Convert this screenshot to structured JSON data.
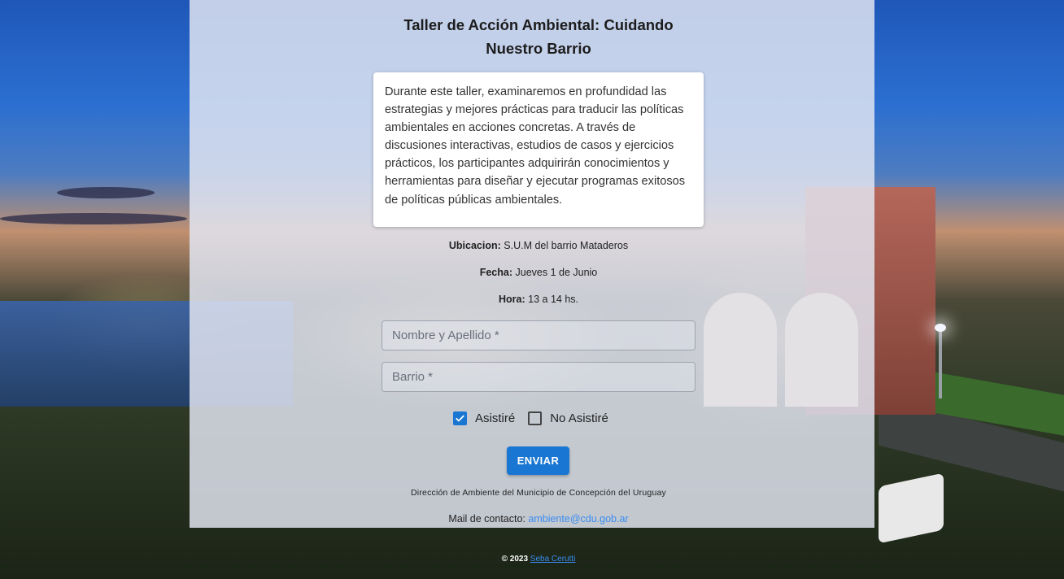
{
  "event": {
    "title": "Taller de Acción Ambiental: Cuidando Nuestro Barrio",
    "description": "Durante este taller, examinaremos en profundidad las estrategias y mejores prácticas para traducir las políticas ambientales en acciones concretas. A través de discusiones interactivas, estudios de casos y ejercicios prácticos, los participantes adquirirán conocimientos y herramientas para diseñar y ejecutar programas exitosos de políticas públicas ambientales.",
    "location_label": "Ubicacion:",
    "location_value": "S.U.M del barrio Mataderos",
    "date_label": "Fecha:",
    "date_value": "Jueves 1 de Junio",
    "hour_label": "Hora:",
    "hour_value": "13 a 14 hs."
  },
  "form": {
    "name_placeholder": "Nombre y Apellido *",
    "barrio_placeholder": "Barrio *",
    "attend_label": "Asistiré",
    "attend_checked": true,
    "not_attend_label": "No Asistiré",
    "not_attend_checked": false,
    "submit_label": "ENVIAR"
  },
  "contact": {
    "organization": "Dirección de Ambiente del Municipio de Concepción del Uruguay",
    "mail_label": "Mail de contacto:",
    "mail_value": "ambiente@cdu.gob.ar"
  },
  "footer": {
    "copyright": "© 2023",
    "author": "Seba Cerutti"
  },
  "colors": {
    "accent": "#1976d2",
    "link": "#3a8cf0"
  }
}
